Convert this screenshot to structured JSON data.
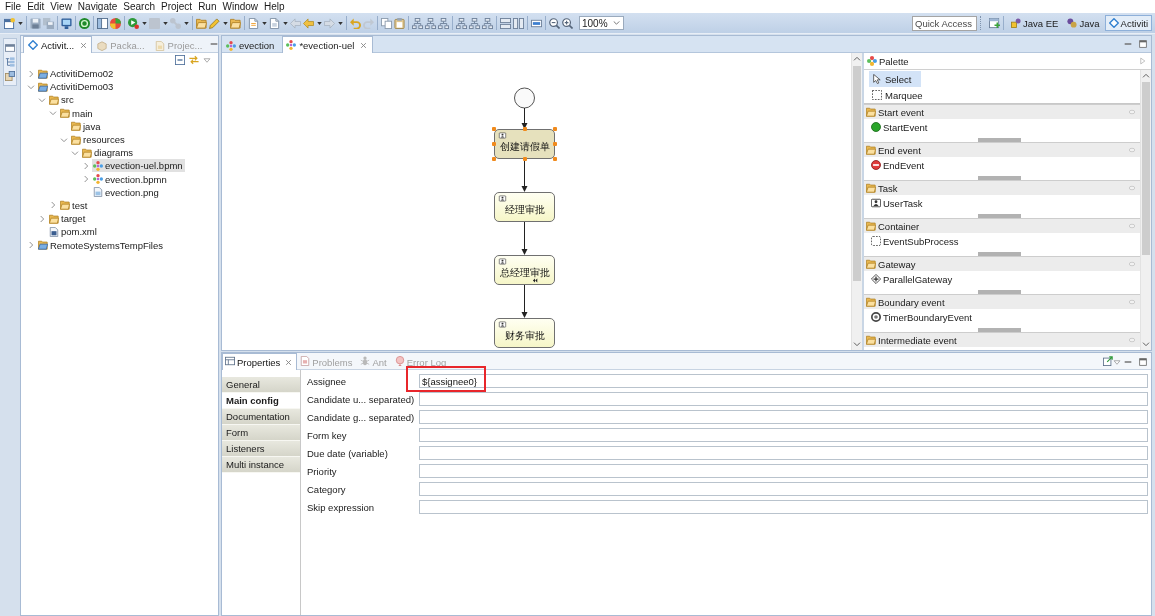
{
  "menu_bar": [
    "File",
    "Edit",
    "View",
    "Navigate",
    "Search",
    "Project",
    "Run",
    "Window",
    "Help"
  ],
  "toolbar": {
    "zoom": "100%",
    "quick_access": {
      "placeholder": "Quick Access"
    },
    "perspectives": [
      {
        "label": "Java EE",
        "selected": false
      },
      {
        "label": "Java",
        "selected": false
      },
      {
        "label": "Activiti",
        "selected": true
      }
    ]
  },
  "explorer": {
    "tabs": [
      {
        "label": "Activit...",
        "selected": true
      },
      {
        "label": "Packa...",
        "selected": false
      },
      {
        "label": "Projec...",
        "selected": false
      }
    ],
    "tree": [
      {
        "label": "ActivitiDemo02",
        "kind": "project",
        "expanded": false,
        "selected": false
      },
      {
        "label": "ActivitiDemo03",
        "kind": "project",
        "expanded": true,
        "selected": false,
        "children": [
          {
            "label": "src",
            "kind": "folder",
            "expanded": true,
            "selected": false,
            "children": [
              {
                "label": "main",
                "kind": "folder",
                "expanded": true,
                "selected": false,
                "children": [
                  {
                    "label": "java",
                    "kind": "folder",
                    "selected": false
                  },
                  {
                    "label": "resources",
                    "kind": "folder",
                    "expanded": true,
                    "selected": false,
                    "children": [
                      {
                        "label": "diagrams",
                        "kind": "folder",
                        "expanded": true,
                        "selected": false,
                        "children": [
                          {
                            "label": "evection-uel.bpmn",
                            "kind": "bpmn",
                            "expanded": false,
                            "selected": true
                          },
                          {
                            "label": "evection.bpmn",
                            "kind": "bpmn",
                            "expanded": false,
                            "selected": false
                          },
                          {
                            "label": "evection.png",
                            "kind": "image",
                            "selected": false
                          }
                        ]
                      }
                    ]
                  }
                ]
              },
              {
                "label": "test",
                "kind": "folder",
                "expanded": false,
                "selected": false
              }
            ]
          },
          {
            "label": "target",
            "kind": "folder",
            "expanded": false,
            "selected": false
          },
          {
            "label": "pom.xml",
            "kind": "xml",
            "selected": false
          }
        ]
      },
      {
        "label": "RemoteSystemsTempFiles",
        "kind": "project",
        "expanded": false,
        "selected": false
      }
    ]
  },
  "editor": {
    "tabs": [
      {
        "label": "evection",
        "selected": false
      },
      {
        "label": "*evection-uel",
        "selected": true
      }
    ],
    "diagram": {
      "tasks": [
        {
          "name": "创建请假单",
          "selected": true,
          "for_compensation": false
        },
        {
          "name": "经理审批",
          "selected": false,
          "for_compensation": false
        },
        {
          "name": "总经理审批",
          "selected": false,
          "for_compensation": true
        },
        {
          "name": "财务审批",
          "selected": false,
          "for_compensation": false
        }
      ]
    }
  },
  "palette": {
    "title": "Palette",
    "tools": [
      {
        "label": "Select",
        "kind": "select",
        "selected": true
      },
      {
        "label": "Marquee",
        "kind": "marquee",
        "selected": false
      }
    ],
    "drawers": [
      {
        "label": "Start event",
        "items": [
          {
            "label": "StartEvent",
            "kind": "start_event"
          }
        ]
      },
      {
        "label": "End event",
        "items": [
          {
            "label": "EndEvent",
            "kind": "end_event"
          }
        ]
      },
      {
        "label": "Task",
        "items": [
          {
            "label": "UserTask",
            "kind": "user_task"
          }
        ]
      },
      {
        "label": "Container",
        "items": [
          {
            "label": "EventSubProcess",
            "kind": "sub_process"
          }
        ]
      },
      {
        "label": "Gateway",
        "items": [
          {
            "label": "ParallelGateway",
            "kind": "parallel_gateway"
          }
        ]
      },
      {
        "label": "Boundary event",
        "items": [
          {
            "label": "TimerBoundaryEvent",
            "kind": "timer_event"
          }
        ]
      },
      {
        "label": "Intermediate event"
      }
    ]
  },
  "properties": {
    "tabs": [
      {
        "label": "Properties",
        "selected": true
      },
      {
        "label": "Problems",
        "selected": false
      },
      {
        "label": "Ant",
        "selected": false
      },
      {
        "label": "Error Log",
        "selected": false
      }
    ],
    "sections": [
      {
        "label": "General",
        "selected": false
      },
      {
        "label": "Main config",
        "selected": true
      },
      {
        "label": "Documentation",
        "selected": false
      },
      {
        "label": "Form",
        "selected": false
      },
      {
        "label": "Listeners",
        "selected": false
      },
      {
        "label": "Multi instance",
        "selected": false
      }
    ],
    "fields": [
      {
        "label": "Assignee",
        "value": "${assignee0}",
        "highlighted": true
      },
      {
        "label": "Candidate u... separated)",
        "highlighted": false
      },
      {
        "label": "Candidate g... separated)",
        "highlighted": false
      },
      {
        "label": "Form key",
        "highlighted": false
      },
      {
        "label": "Due date (variable)",
        "highlighted": false
      },
      {
        "label": "Priority",
        "highlighted": false
      },
      {
        "label": "Category",
        "highlighted": false
      },
      {
        "label": "Skip expression",
        "highlighted": false
      }
    ]
  }
}
